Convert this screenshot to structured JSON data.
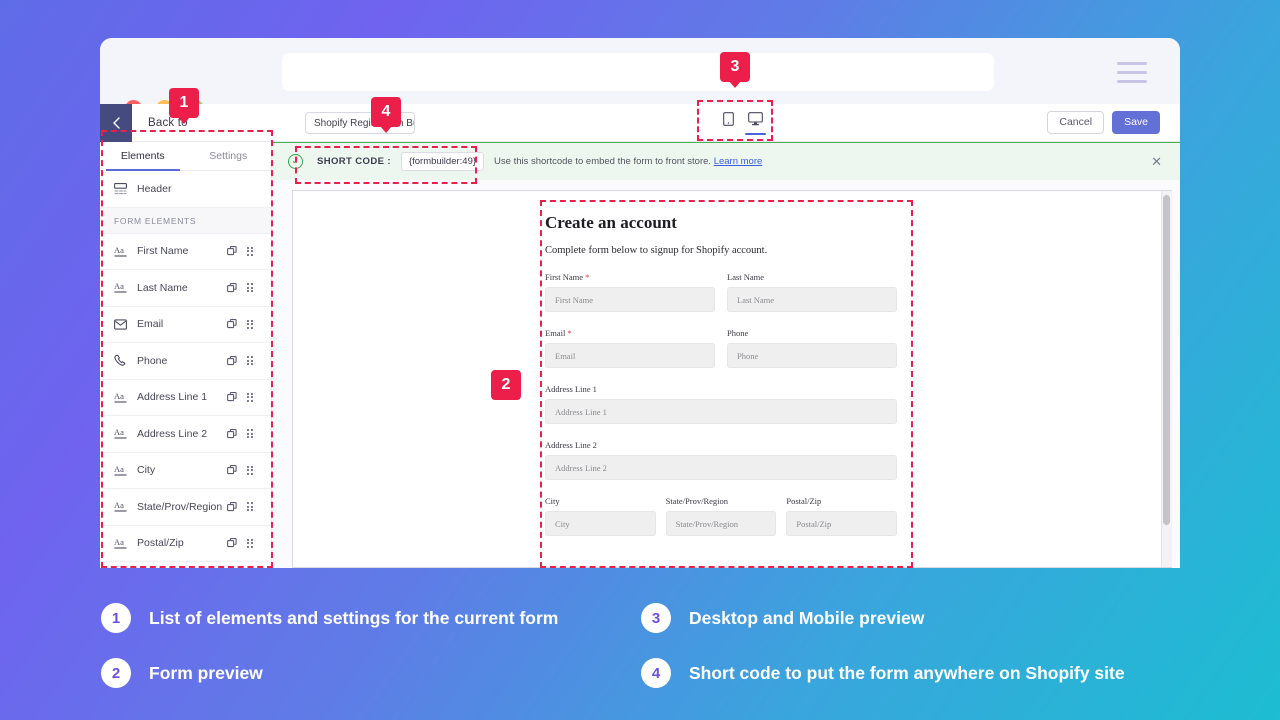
{
  "browser": {
    "traffic_lights": [
      "close",
      "minimize",
      "maximize"
    ],
    "url_value": "",
    "menu_icon": "hamburger-icon"
  },
  "appbar": {
    "back_label": "Back to",
    "back_icon": "chevron-left-icon",
    "form_name": "Shopify Registration Builder",
    "devices": [
      {
        "name": "mobile",
        "icon": "mobile-icon",
        "active": false
      },
      {
        "name": "desktop",
        "icon": "desktop-icon",
        "active": true
      }
    ],
    "cancel_label": "Cancel",
    "save_label": "Save"
  },
  "sidebar": {
    "tabs": [
      {
        "label": "Elements",
        "active": true
      },
      {
        "label": "Settings",
        "active": false
      }
    ],
    "top_items": [
      {
        "label": "Header",
        "icon": "header-icon"
      }
    ],
    "section_title": "FORM ELEMENTS",
    "items": [
      {
        "label": "First Name",
        "icon": "text-field-icon"
      },
      {
        "label": "Last Name",
        "icon": "text-field-icon"
      },
      {
        "label": "Email",
        "icon": "email-icon"
      },
      {
        "label": "Phone",
        "icon": "phone-icon"
      },
      {
        "label": "Address Line 1",
        "icon": "text-field-icon"
      },
      {
        "label": "Address Line 2",
        "icon": "text-field-icon"
      },
      {
        "label": "City",
        "icon": "text-field-icon"
      },
      {
        "label": "State/Prov/Region",
        "icon": "text-field-icon"
      },
      {
        "label": "Postal/Zip",
        "icon": "text-field-icon"
      }
    ],
    "row_actions": [
      "duplicate-icon",
      "drag-handle-icon"
    ]
  },
  "shortcode_bar": {
    "status_icon": "check-circle-icon",
    "label": "SHORT CODE :",
    "value": "{formbuilder:49}",
    "hint": "Use this shortcode to embed the form to front store.",
    "link": "Learn more",
    "close_icon": "close-icon"
  },
  "form_preview": {
    "title": "Create an account",
    "subtitle": "Complete form below to signup for Shopify account.",
    "rows": [
      {
        "fields": [
          {
            "label": "First Name",
            "required": true,
            "placeholder": "First Name"
          },
          {
            "label": "Last Name",
            "required": false,
            "placeholder": "Last Name"
          }
        ]
      },
      {
        "fields": [
          {
            "label": "Email",
            "required": true,
            "placeholder": "Email"
          },
          {
            "label": "Phone",
            "required": false,
            "placeholder": "Phone"
          }
        ]
      },
      {
        "fields": [
          {
            "label": "Address Line 1",
            "required": false,
            "placeholder": "Address Line 1"
          }
        ]
      },
      {
        "fields": [
          {
            "label": "Address Line 2",
            "required": false,
            "placeholder": "Address Line 2"
          }
        ]
      },
      {
        "fields": [
          {
            "label": "City",
            "required": false,
            "placeholder": "City"
          },
          {
            "label": "State/Prov/Region",
            "required": false,
            "placeholder": "State/Prov/Region"
          },
          {
            "label": "Postal/Zip",
            "required": false,
            "placeholder": "Postal/Zip"
          }
        ]
      }
    ]
  },
  "annotations": {
    "badges": [
      "1",
      "2",
      "3",
      "4"
    ],
    "accent_color": "#ec1f4b"
  },
  "legend": {
    "items": [
      {
        "num": "1",
        "text": "List of elements and settings for the current form"
      },
      {
        "num": "2",
        "text": "Form preview"
      },
      {
        "num": "3",
        "text": "Desktop and Mobile preview"
      },
      {
        "num": "4",
        "text": "Short code to put the form anywhere on Shopify site"
      }
    ]
  }
}
